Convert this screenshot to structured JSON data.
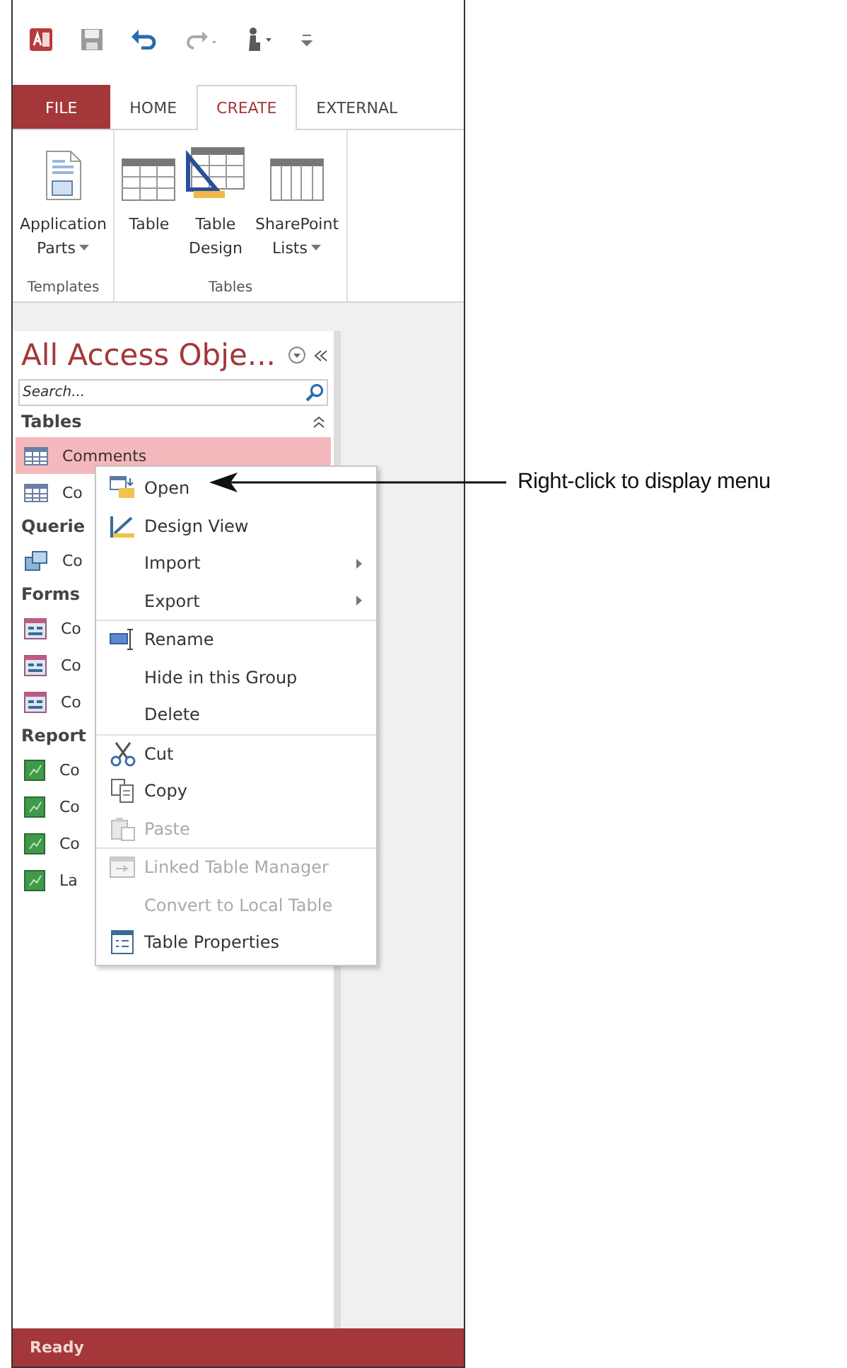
{
  "ribbon": {
    "tabs": [
      {
        "label": "FILE",
        "kind": "file",
        "selected": false
      },
      {
        "label": "HOME",
        "kind": "tab",
        "selected": false
      },
      {
        "label": "CREATE",
        "kind": "tab",
        "selected": true
      },
      {
        "label": "EXTERNAL",
        "kind": "tab",
        "selected": false
      }
    ],
    "groups": [
      {
        "label": "Templates",
        "buttons": [
          {
            "label": "Application Parts",
            "kind": "parts",
            "dropdown": true
          }
        ]
      },
      {
        "label": "Tables",
        "buttons": [
          {
            "label": "Table",
            "kind": "table",
            "dropdown": false
          },
          {
            "label": "Table Design",
            "kind": "design",
            "dropdown": false
          },
          {
            "label": "SharePoint Lists",
            "kind": "sharepoint",
            "dropdown": true
          }
        ]
      }
    ]
  },
  "nav_pane": {
    "title": "All Access Obje...",
    "search": {
      "placeholder": "Search..."
    },
    "groups": [
      {
        "label": "Tables",
        "items": [
          {
            "label": "Comments",
            "kind": "table",
            "selected": true
          },
          {
            "label": "Co",
            "kind": "table",
            "selected": false
          }
        ]
      },
      {
        "label": "Querie",
        "items": [
          {
            "label": "Co",
            "kind": "query",
            "selected": false
          }
        ]
      },
      {
        "label": "Forms",
        "items": [
          {
            "label": "Co",
            "kind": "form",
            "selected": false
          },
          {
            "label": "Co",
            "kind": "form",
            "selected": false
          },
          {
            "label": "Co",
            "kind": "form",
            "selected": false
          }
        ]
      },
      {
        "label": "Report",
        "items": [
          {
            "label": "Co",
            "kind": "report",
            "selected": false
          },
          {
            "label": "Co",
            "kind": "report",
            "selected": false
          },
          {
            "label": "Co",
            "kind": "report",
            "selected": false
          },
          {
            "label": "La",
            "kind": "report",
            "selected": false
          }
        ]
      }
    ]
  },
  "context_menu": {
    "sections": [
      [
        {
          "label": "Open",
          "kind": "open",
          "submenu": false,
          "disabled": false
        },
        {
          "label": "Design View",
          "kind": "design",
          "submenu": false,
          "disabled": false
        },
        {
          "label": "Import",
          "kind": "plain",
          "submenu": true,
          "disabled": false
        },
        {
          "label": "Export",
          "kind": "plain",
          "submenu": true,
          "disabled": false
        }
      ],
      [
        {
          "label": "Rename",
          "kind": "rename",
          "submenu": false,
          "disabled": false
        },
        {
          "label": "Hide in this Group",
          "kind": "plain",
          "submenu": false,
          "disabled": false
        },
        {
          "label": "Delete",
          "kind": "plain",
          "submenu": false,
          "disabled": false
        }
      ],
      [
        {
          "label": "Cut",
          "kind": "cut",
          "submenu": false,
          "disabled": false
        },
        {
          "label": "Copy",
          "kind": "copy",
          "submenu": false,
          "disabled": false
        },
        {
          "label": "Paste",
          "kind": "paste",
          "submenu": false,
          "disabled": true
        }
      ],
      [
        {
          "label": "Linked Table Manager",
          "kind": "linked",
          "submenu": false,
          "disabled": true
        },
        {
          "label": "Convert to Local Table",
          "kind": "plain",
          "submenu": false,
          "disabled": true
        },
        {
          "label": "Table Properties",
          "kind": "properties",
          "submenu": false,
          "disabled": false
        }
      ]
    ]
  },
  "status_bar": {
    "text": "Ready"
  },
  "callout": {
    "text": "Right-click to display menu"
  }
}
